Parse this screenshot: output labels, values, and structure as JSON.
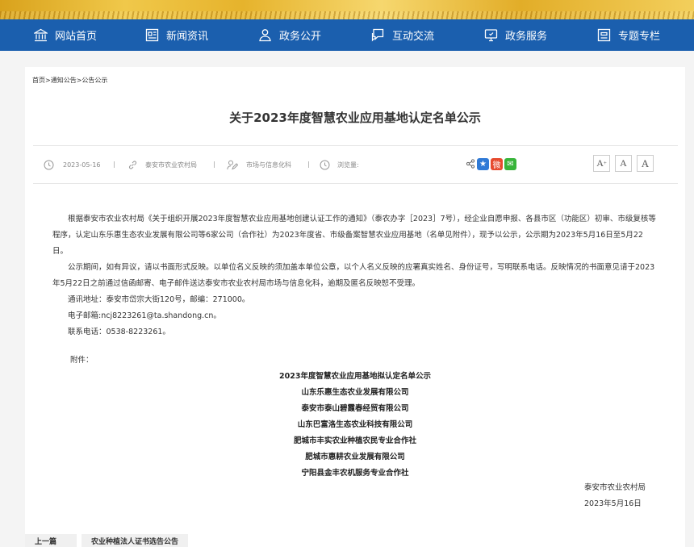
{
  "nav": {
    "items": [
      {
        "label": "网站首页",
        "icon": "bank-icon"
      },
      {
        "label": "新闻资讯",
        "icon": "news-icon"
      },
      {
        "label": "政务公开",
        "icon": "person-icon"
      },
      {
        "label": "互动交流",
        "icon": "chat-icon"
      },
      {
        "label": "政务服务",
        "icon": "monitor-icon"
      },
      {
        "label": "专题专栏",
        "icon": "board-icon"
      }
    ]
  },
  "breadcrumb": [
    "首页",
    "通知公告",
    "公告公示"
  ],
  "breadcrumb_sep": ">",
  "article": {
    "title": "关于2023年度智慧农业应用基地认定名单公示",
    "date": "2023-05-16",
    "publisher": "泰安市农业农村局",
    "department": "市场与信息化科",
    "views_label": "浏览量:",
    "font_sizes": [
      "A+",
      "A",
      "A"
    ],
    "paragraphs": [
      "根据泰安市农业农村局《关于组织开展2023年度智慧农业应用基地创建认证工作的通知》（泰农办字［2023］7号），经企业自愿申报、各县市区（功能区）初审、市级复核等程序，认定山东乐惠生态农业发展有限公司等6家公司（合作社）为2023年度省、市级备案智慧农业应用基地（名单见附件），现予以公示，公示期为2023年5月16日至5月22日。",
      "公示期间，如有异议，请以书面形式反映。以单位名义反映的须加盖本单位公章，以个人名义反映的应署真实姓名、身份证号，写明联系电话。反映情况的书面意见请于2023年5月22日之前通过信函邮寄、电子邮件送达泰安市农业农村局市场与信息化科，逾期及匿名反映恕不受理。"
    ],
    "contact_lines": [
      "通讯地址：泰安市岱宗大街120号，邮编：271000。",
      "电子邮箱:ncj8223261@ta.shandong.cn。",
      "联系电话：0538-8223261。"
    ],
    "attachment_label": "附件：",
    "list_title": "2023年度智慧农业应用基地拟认定名单公示",
    "list": [
      "山东乐惠生态农业发展有限公司",
      "泰安市泰山碧霞春经贸有限公司",
      "山东巴富洛生态农业科技有限公司",
      "肥城市丰实农业种植农民专业合作社",
      "肥城市惠耕农业发展有限公司",
      "宁阳县金丰农机服务专业合作社"
    ],
    "signature": "泰安市农业农村局",
    "sign_date": "2023年5月16日"
  },
  "bottom_tabs": [
    "上一篇",
    "农业种植法人证书选告公告"
  ],
  "colors": {
    "nav_bg": "#1b5fae",
    "page_bg": "#f4f4f4"
  }
}
